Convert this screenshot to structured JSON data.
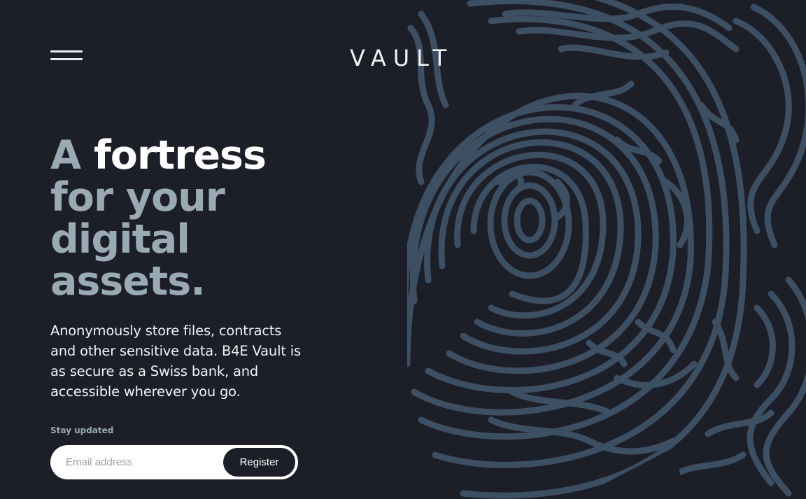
{
  "header": {
    "logo_text": "VAULT",
    "menu_icon": "hamburger-icon"
  },
  "hero": {
    "headline": {
      "line1_accent": "A ",
      "line1_highlight": "fortress",
      "line2": "for your",
      "line3": "digital",
      "line4": "assets."
    },
    "description": "Anonymously store files, contracts and other sensitive data. B4E Vault is as secure as a Swiss bank, and accessible wherever you go."
  },
  "signup": {
    "label": "Stay updated",
    "email_placeholder": "Email address",
    "email_value": "",
    "register_label": "Register"
  },
  "colors": {
    "background": "#1c1e28",
    "headline_muted": "#9aaab4",
    "headline_highlight": "#ffffff",
    "pattern": "#3d4f63"
  }
}
